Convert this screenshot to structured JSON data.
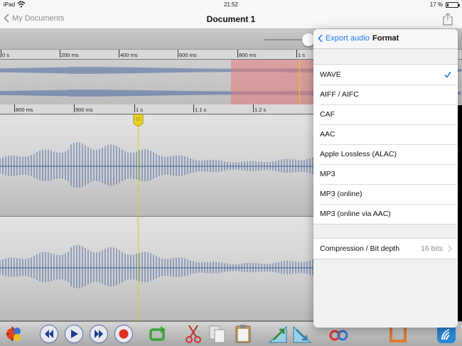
{
  "status": {
    "device": "iPad",
    "time": "21:52",
    "battery_text": "17 %",
    "battery_level": 0.17
  },
  "nav": {
    "back_label": "My Documents",
    "title": "Document 1"
  },
  "zoom": {
    "level": 0.88
  },
  "overview_ruler": {
    "ticks": [
      "0 s",
      "200 ms",
      "400 ms",
      "600 ms",
      "800 ms",
      "1 s"
    ]
  },
  "detail_ruler": {
    "ticks": [
      "800 ms",
      "900 ms",
      "1 s",
      "1.1 s",
      "1.2 s"
    ]
  },
  "popover": {
    "back_label": "Export audio",
    "title": "Format",
    "formats": [
      "WAVE",
      "AIFF / AIFC",
      "CAF",
      "AAC",
      "Apple Lossless (ALAC)",
      "MP3",
      "MP3 (online)",
      "MP3 (online via AAC)"
    ],
    "selected_format": "WAVE",
    "compression_label": "Compression / Bit depth",
    "compression_value": "16 bits"
  },
  "colors": {
    "accent": "#1a7cf5",
    "waveform": "#3c5f9e",
    "selection": "#e47878",
    "playhead": "#d6d600"
  }
}
